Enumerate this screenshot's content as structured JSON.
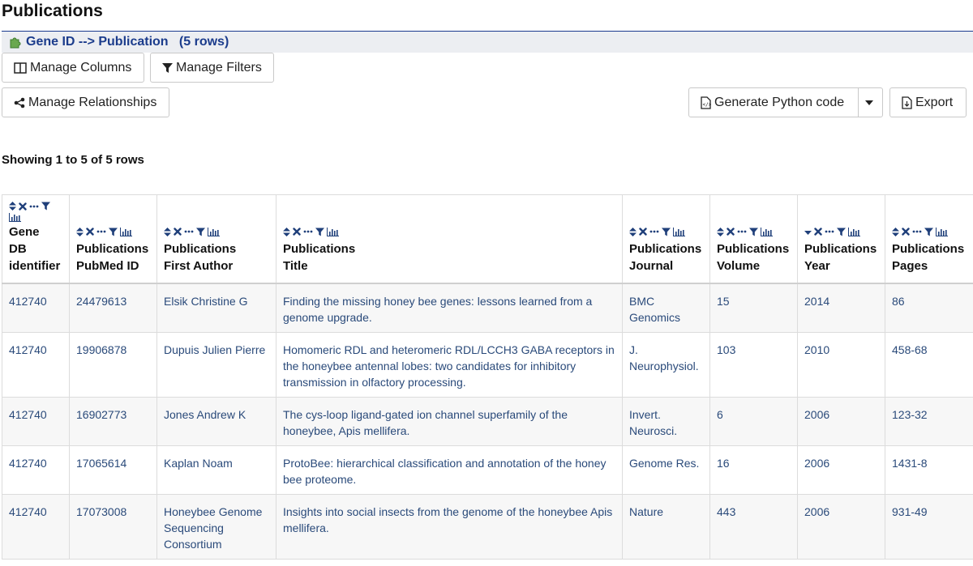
{
  "page_title": "Publications",
  "path": {
    "label": "Gene ID --> Publication",
    "count": "(5 rows)"
  },
  "buttons": {
    "manage_columns": "Manage Columns",
    "manage_filters": "Manage Filters",
    "manage_relationships": "Manage Relationships",
    "generate_code": "Generate Python code",
    "export": "Export"
  },
  "showing": "Showing 1 to 5 of 5 rows",
  "table": {
    "columns": [
      {
        "line1": "Gene",
        "line2": "DB",
        "line3": "identifier"
      },
      {
        "line1": "Publications",
        "line2": "PubMed ID"
      },
      {
        "line1": "Publications",
        "line2": "First Author"
      },
      {
        "line1": "Publications",
        "line2": "Title"
      },
      {
        "line1": "Publications",
        "line2": "Journal"
      },
      {
        "line1": "Publications",
        "line2": "Volume"
      },
      {
        "line1": "Publications",
        "line2": "Year"
      },
      {
        "line1": "Publications",
        "line2": "Pages"
      }
    ],
    "rows": [
      [
        "412740",
        "24479613",
        "Elsik Christine G",
        "Finding the missing honey bee genes: lessons learned from a genome upgrade.",
        "BMC Genomics",
        "15",
        "2014",
        "86"
      ],
      [
        "412740",
        "19906878",
        "Dupuis Julien Pierre",
        "Homomeric RDL and heteromeric RDL/LCCH3 GABA receptors in the honeybee antennal lobes: two candidates for inhibitory transmission in olfactory processing.",
        "J. Neurophysiol.",
        "103",
        "2010",
        "458-68"
      ],
      [
        "412740",
        "16902773",
        "Jones Andrew K",
        "The cys-loop ligand-gated ion channel superfamily of the honeybee, Apis mellifera.",
        "Invert. Neurosci.",
        "6",
        "2006",
        "123-32"
      ],
      [
        "412740",
        "17065614",
        "Kaplan Noam",
        "ProtoBee: hierarchical classification and annotation of the honey bee proteome.",
        "Genome Res.",
        "16",
        "2006",
        "1431-8"
      ],
      [
        "412740",
        "17073008",
        "Honeybee Genome Sequencing Consortium",
        "Insights into social insects from the genome of the honeybee Apis mellifera.",
        "Nature",
        "443",
        "2006",
        "931-49"
      ]
    ]
  },
  "colors": {
    "accent": "#1b3c8c",
    "cell_text": "#2a4a7a",
    "icon": "#1f3f7a"
  },
  "icons": [
    "puzzle-icon",
    "columns-icon",
    "filter-icon",
    "share-icon",
    "code-file-icon",
    "caret-down-icon",
    "export-file-icon",
    "sort-icon",
    "remove-icon",
    "more-icon",
    "column-filter-icon",
    "summary-chart-icon"
  ]
}
